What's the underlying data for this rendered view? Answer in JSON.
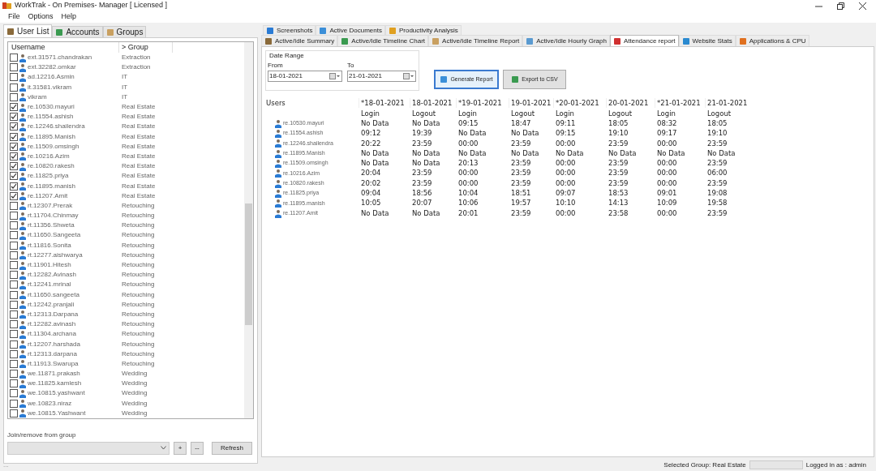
{
  "window": {
    "title": "WorkTrak - On Premises- Manager [ Licensed ]"
  },
  "menu": [
    "File",
    "Options",
    "Help"
  ],
  "left_tabs": [
    {
      "label": "User List",
      "selected": true
    },
    {
      "label": "Accounts",
      "selected": false
    },
    {
      "label": "Groups",
      "selected": false
    }
  ],
  "user_list": {
    "columns": [
      "Username",
      "> Group"
    ],
    "rows": [
      {
        "checked": false,
        "username": "ext.31571.chandrakan",
        "group": "Extraction"
      },
      {
        "checked": false,
        "username": "ext.32282.omkar",
        "group": "Extraction"
      },
      {
        "checked": false,
        "username": "ad.12216.Asmin",
        "group": "IT"
      },
      {
        "checked": false,
        "username": "it.31581.vikram",
        "group": "IT"
      },
      {
        "checked": false,
        "username": "vikram",
        "group": "IT"
      },
      {
        "checked": true,
        "username": "re.10530.mayuri",
        "group": "Real Estate"
      },
      {
        "checked": true,
        "username": "re.11554.ashish",
        "group": "Real Estate"
      },
      {
        "checked": true,
        "username": "re.12246.shailendra",
        "group": "Real Estate"
      },
      {
        "checked": true,
        "username": "re.11895.Manish",
        "group": "Real Estate"
      },
      {
        "checked": true,
        "username": "re.11509.omsingh",
        "group": "Real Estate"
      },
      {
        "checked": true,
        "username": "re.10216.Azim",
        "group": "Real Estate"
      },
      {
        "checked": true,
        "username": "re.10820.rakesh",
        "group": "Real Estate"
      },
      {
        "checked": true,
        "username": "re.11825.priya",
        "group": "Real Estate"
      },
      {
        "checked": true,
        "username": "re.11895.manish",
        "group": "Real Estate"
      },
      {
        "checked": true,
        "username": "re.11207.Amit",
        "group": "Real Estate"
      },
      {
        "checked": false,
        "username": "rt.12307.Prerak",
        "group": "Retouching"
      },
      {
        "checked": false,
        "username": "rt.11704.Chinmay",
        "group": "Retouching"
      },
      {
        "checked": false,
        "username": "rt.11356.Shweta",
        "group": "Retouching"
      },
      {
        "checked": false,
        "username": "rt.11650.Sangeeta",
        "group": "Retouching"
      },
      {
        "checked": false,
        "username": "rt.11816.Sonita",
        "group": "Retouching"
      },
      {
        "checked": false,
        "username": "rt.12277.aishwarya",
        "group": "Retouching"
      },
      {
        "checked": false,
        "username": "rt.11901.Hitesh",
        "group": "Retouching"
      },
      {
        "checked": false,
        "username": "rt.12282.Avinash",
        "group": "Retouching"
      },
      {
        "checked": false,
        "username": "rt.12241.mrinal",
        "group": "Retouching"
      },
      {
        "checked": false,
        "username": "rt.11650.sangeeta",
        "group": "Retouching"
      },
      {
        "checked": false,
        "username": "rt.12242.pranjali",
        "group": "Retouching"
      },
      {
        "checked": false,
        "username": "rt.12313.Darpana",
        "group": "Retouching"
      },
      {
        "checked": false,
        "username": "rt.12282.avinash",
        "group": "Retouching"
      },
      {
        "checked": false,
        "username": "rt.11304.archana",
        "group": "Retouching"
      },
      {
        "checked": false,
        "username": "rt.12207.harshada",
        "group": "Retouching"
      },
      {
        "checked": false,
        "username": "rt.12313.darpana",
        "group": "Retouching"
      },
      {
        "checked": false,
        "username": "rt.11913.Swarupa",
        "group": "Retouching"
      },
      {
        "checked": false,
        "username": "we.11871.prakash",
        "group": "Wedding"
      },
      {
        "checked": false,
        "username": "we.11825.kamlesh",
        "group": "Wedding"
      },
      {
        "checked": false,
        "username": "we.10815.yashwant",
        "group": "Wedding"
      },
      {
        "checked": false,
        "username": "we.10823.niraz",
        "group": "Wedding"
      },
      {
        "checked": false,
        "username": "we.10815.Yashwant",
        "group": "Wedding"
      }
    ]
  },
  "group_join": {
    "label": "Join/remove from group",
    "buttons": [
      "+",
      "--",
      "Refresh"
    ]
  },
  "tabs_row_1": [
    {
      "label": "Screenshots",
      "selected": false
    },
    {
      "label": "Active Documents",
      "selected": false
    },
    {
      "label": "Productivity Analysis",
      "selected": false
    }
  ],
  "tabs_row_2": [
    {
      "label": "Active/Idle Summary",
      "selected": false
    },
    {
      "label": "Active/Idle Timeline Chart",
      "selected": false
    },
    {
      "label": "Active/Idle Timeline Report",
      "selected": false
    },
    {
      "label": "Active/Idle Hourly Graph",
      "selected": false
    },
    {
      "label": "Attendance report",
      "selected": true
    },
    {
      "label": "Website Stats",
      "selected": false
    },
    {
      "label": "Applications & CPU",
      "selected": false
    }
  ],
  "date_range": {
    "title": "Date Range",
    "from_label": "From",
    "from": "18-01-2021",
    "to_label": "To",
    "to": "21-01-2021"
  },
  "actions": [
    "Generate Report",
    "Export to CSV"
  ],
  "report": {
    "users_heading": "Users",
    "dates": [
      "*18-01-2021",
      "18-01-2021",
      "*19-01-2021",
      "19-01-2021",
      "*20-01-2021",
      "20-01-2021",
      "*21-01-2021",
      "21-01-2021"
    ],
    "kinds": [
      "Login",
      "Logout",
      "Login",
      "Logout",
      "Login",
      "Logout",
      "Login",
      "Logout"
    ],
    "rows": [
      {
        "user": "re.10530.mayuri",
        "cells": [
          "No Data",
          "No Data",
          "09:15",
          "18:47",
          "09:11",
          "18:05",
          "08:32",
          "18:05"
        ]
      },
      {
        "user": "re.11554.ashish",
        "cells": [
          "09:12",
          "19:39",
          "No Data",
          "No Data",
          "09:15",
          "19:10",
          "09:17",
          "19:10"
        ]
      },
      {
        "user": "re.12246.shailendra",
        "cells": [
          "20:22",
          "23:59",
          "00:00",
          "23:59",
          "00:00",
          "23:59",
          "00:00",
          "23:59"
        ]
      },
      {
        "user": "re.11895.Manish",
        "cells": [
          "No Data",
          "No Data",
          "No Data",
          "No Data",
          "No Data",
          "No Data",
          "No Data",
          "No Data"
        ]
      },
      {
        "user": "re.11509.omsingh",
        "cells": [
          "No Data",
          "No Data",
          "20:13",
          "23:59",
          "00:00",
          "23:59",
          "00:00",
          "23:59"
        ]
      },
      {
        "user": "re.10216.Azim",
        "cells": [
          "20:04",
          "23:59",
          "00:00",
          "23:59",
          "00:00",
          "23:59",
          "00:00",
          "06:00"
        ]
      },
      {
        "user": "re.10820.rakesh",
        "cells": [
          "20:02",
          "23:59",
          "00:00",
          "23:59",
          "00:00",
          "23:59",
          "00:00",
          "23:59"
        ]
      },
      {
        "user": "re.11825.priya",
        "cells": [
          "09:04",
          "18:56",
          "10:04",
          "18:51",
          "09:07",
          "18:53",
          "09:01",
          "19:08"
        ]
      },
      {
        "user": "re.11895.manish",
        "cells": [
          "10:05",
          "20:07",
          "10:06",
          "19:57",
          "10:10",
          "14:13",
          "10:09",
          "19:58"
        ]
      },
      {
        "user": "re.11207.Amit",
        "cells": [
          "No Data",
          "No Data",
          "20:01",
          "23:59",
          "00:00",
          "23:58",
          "00:00",
          "23:59"
        ]
      }
    ]
  },
  "status_bar": {
    "left": "...",
    "selected_group": "Selected Group: Real Estate",
    "logged_in": "Logged in as : admin"
  }
}
